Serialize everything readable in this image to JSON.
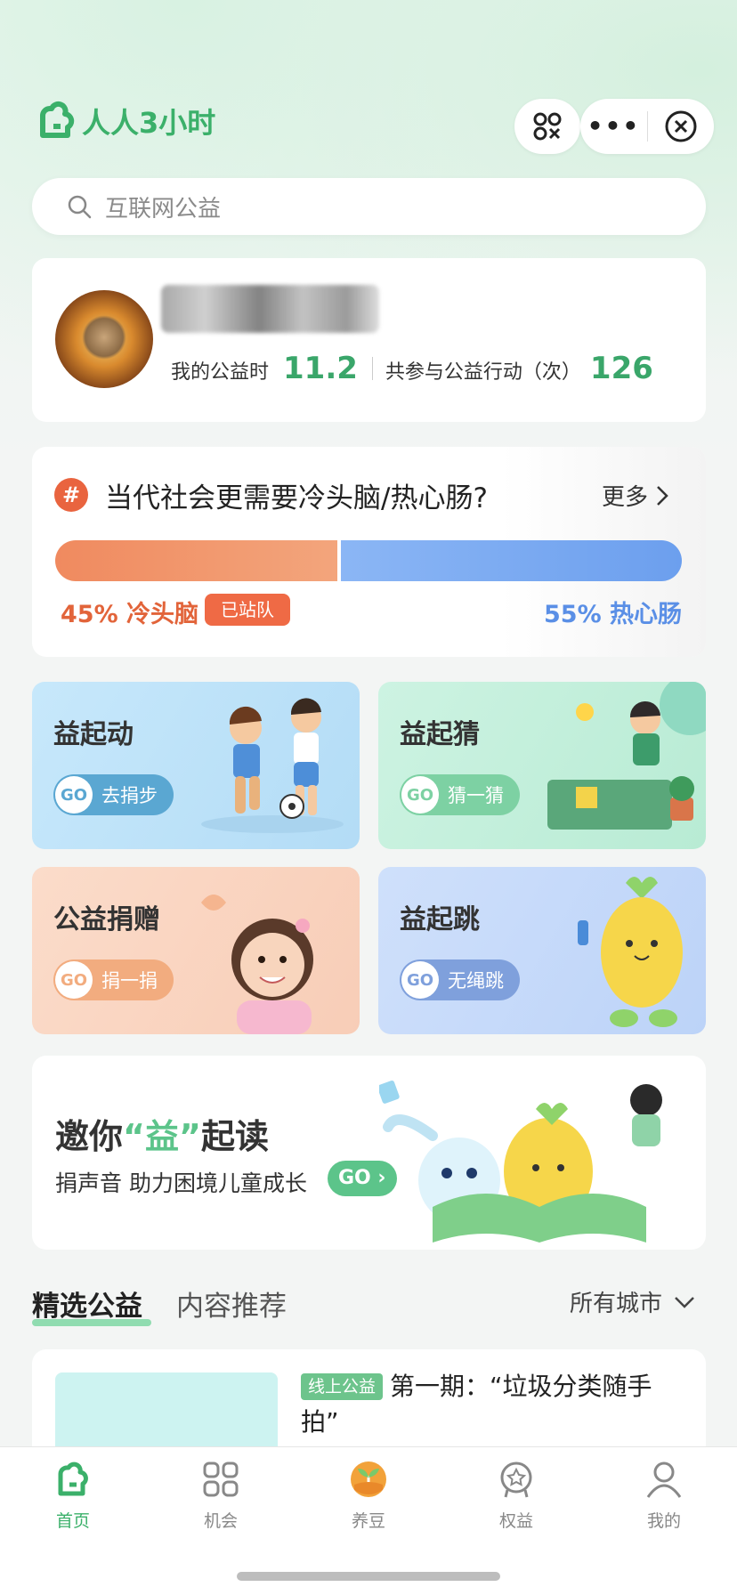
{
  "app": {
    "logo_text": "人人3小时"
  },
  "search": {
    "placeholder": "互联网公益"
  },
  "profile": {
    "hours_label": "我的公益时",
    "hours_value": "11.2",
    "actions_label": "共参与公益行动（次）",
    "actions_value": "126"
  },
  "topic": {
    "title": "当代社会更需要冷头脑/热心肠?",
    "more_label": "更多",
    "left_option": "45% 冷头脑",
    "left_percent": 45,
    "stance_label": "已站队",
    "right_option": "55% 热心肠",
    "right_percent": 55,
    "colors": {
      "left": "#f08a5f",
      "right": "#6c9fee"
    }
  },
  "tiles": [
    {
      "title": "益起动",
      "go": "GO",
      "action": "去捐步"
    },
    {
      "title": "益起猜",
      "go": "GO",
      "action": "猜一猜"
    },
    {
      "title": "公益捐赠",
      "go": "GO",
      "action": "捐一捐"
    },
    {
      "title": "益起跳",
      "go": "GO",
      "action": "无绳跳"
    }
  ],
  "reading": {
    "title_pre": "邀你",
    "title_quote": "“益”",
    "title_post": "起读",
    "subtitle": "捐声音 助力困境儿童成长",
    "go": "GO ›"
  },
  "tabs": {
    "selected": "精选公益",
    "other": "内容推荐",
    "city_filter": "所有城市"
  },
  "list": [
    {
      "tag": "线上公益",
      "title": "第一期：“垃圾分类随手拍”"
    }
  ],
  "nav": [
    {
      "label": "首页",
      "icon": "home-icon",
      "active": true
    },
    {
      "label": "机会",
      "icon": "grid-icon",
      "active": false
    },
    {
      "label": "养豆",
      "icon": "sprout-icon",
      "active": false
    },
    {
      "label": "权益",
      "icon": "badge-icon",
      "active": false
    },
    {
      "label": "我的",
      "icon": "user-icon",
      "active": false
    }
  ],
  "brand_color": "#3bb06a"
}
